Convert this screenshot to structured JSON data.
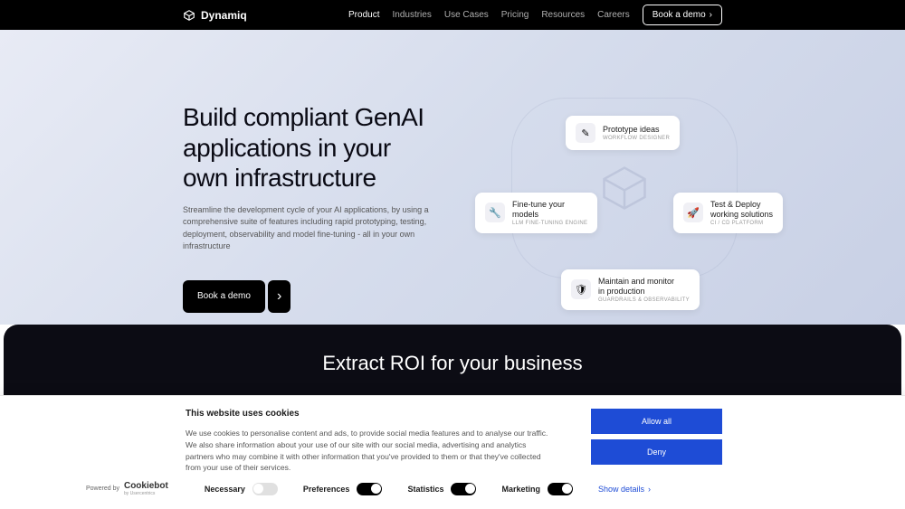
{
  "header": {
    "brand": "Dynamiq",
    "nav": [
      "Product",
      "Industries",
      "Use Cases",
      "Pricing",
      "Resources",
      "Careers"
    ],
    "demo_btn": "Book a demo"
  },
  "hero": {
    "title_l1": "Build compliant GenAI",
    "title_l2": "applications in your",
    "title_l3": "own infrastructure",
    "desc": "Streamline the development cycle of your AI applications, by using a comprehensive suite of features including rapid prototyping, testing, deployment, observability and model fine-tuning - all in your own infrastructure",
    "cta": "Book a demo"
  },
  "features": {
    "top": {
      "title": "Prototype ideas",
      "sub": "WORKFLOW DESIGNER"
    },
    "left": {
      "title_l1": "Fine-tune your",
      "title_l2": "models",
      "sub": "LLM FINE-TUNING ENGINE"
    },
    "right": {
      "title_l1": "Test & Deploy",
      "title_l2": "working solutions",
      "sub": "CI / CD PLATFORM"
    },
    "bottom": {
      "title_l1": "Maintain and monitor",
      "title_l2": "in production",
      "sub": "GUARDRAILS & OBSERVABILITY"
    }
  },
  "section2": {
    "title": "Extract ROI for your business"
  },
  "cookie": {
    "title": "This website uses cookies",
    "desc": "We use cookies to personalise content and ads, to provide social media features and to analyse our traffic. We also share information about your use of our site with our social media, advertising and analytics partners who may combine it with other information that you've provided to them or that they've collected from your use of their services.",
    "allow": "Allow all",
    "deny": "Deny",
    "powered": "Powered by",
    "provider": "Cookiebot",
    "provider_sub": "by Usercentrics",
    "toggles": {
      "necessary": "Necessary",
      "preferences": "Preferences",
      "statistics": "Statistics",
      "marketing": "Marketing"
    },
    "details": "Show details"
  }
}
